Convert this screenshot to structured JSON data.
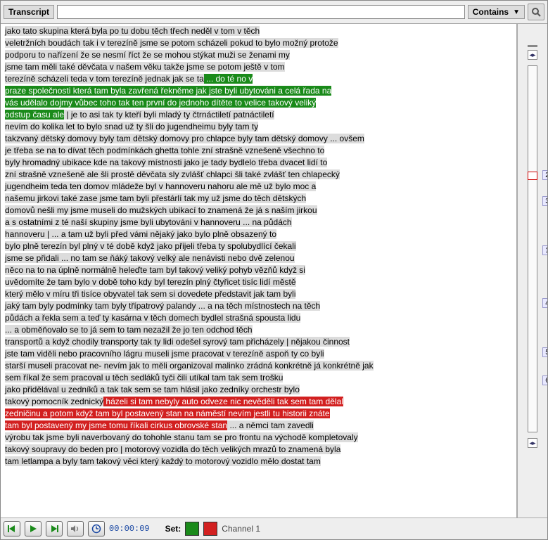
{
  "topbar": {
    "label": "Transcript",
    "input_value": "",
    "dropdown": "Contains"
  },
  "segments": [
    {
      "t": "jako tato skupina která byla po tu dobu těch třech neděl v tom v těch",
      "c": "n"
    },
    {
      "t": "\n"
    },
    {
      "t": "veletržních boudách tak i v terezíně jsme se potom scházeli pokud to bylo možný protože",
      "c": "n"
    },
    {
      "t": "\n"
    },
    {
      "t": "podporu to nařízení že se nesmí říct že se mohou stýkat muži se ženami my",
      "c": "n"
    },
    {
      "t": "\n"
    },
    {
      "t": "jsme tam měli také děvčata v našem věku takže jsme se potom ještě v tom",
      "c": "n"
    },
    {
      "t": "\n"
    },
    {
      "t": "terezíně scházeli teda v tom terezíně jednak jak se ta",
      "c": "n"
    },
    {
      "t": " ... do té no v",
      "c": "g"
    },
    {
      "t": "\n"
    },
    {
      "t": "praze společnosti která tam byla zavřená řekněme jak jste byli ubytováni a celá řada na",
      "c": "g"
    },
    {
      "t": "\n"
    },
    {
      "t": "vás udělalo dojmy vůbec toho tak ten první do jednoho dítěte to velice takový veliký",
      "c": "g"
    },
    {
      "t": "\n"
    },
    {
      "t": "odstup času ale",
      "c": "g"
    },
    {
      "t": " | je to asi tak ty kteří byli mladý ty čtrnáctiletí patnáctiletí",
      "c": "n"
    },
    {
      "t": "\n"
    },
    {
      "t": "nevím do kolika let to bylo snad už ty šli do jugendheimu byly tam ty",
      "c": "n"
    },
    {
      "t": "\n"
    },
    {
      "t": "takzvaný dětský domovy byly tam dětský domovy pro chlapce byly tam dětský domovy ... ovšem",
      "c": "n"
    },
    {
      "t": "\n"
    },
    {
      "t": "je třeba se na to dívat těch podmínkách ghetta tohle zní strašně vznešeně všechno to",
      "c": "n"
    },
    {
      "t": "\n"
    },
    {
      "t": "byly hromadný ubikace kde na takový místnosti jako je tady bydlelo třeba dvacet lidí to",
      "c": "n"
    },
    {
      "t": "\n"
    },
    {
      "t": "zní strašně vznešeně ale šli prostě děvčata sly zvlášť chlapci šli také zvlášť ten chlapecký",
      "c": "n"
    },
    {
      "t": "\n"
    },
    {
      "t": "jugendheim teda ten domov mládeže byl v hannoveru nahoru ale mě už bylo moc a",
      "c": "n"
    },
    {
      "t": "\n"
    },
    {
      "t": "našemu jirkovi také zase jsme tam byli přestárlí tak my už jsme do těch dětských",
      "c": "n"
    },
    {
      "t": "\n"
    },
    {
      "t": "domovů nešli my jsme museli do mužských ubikací to znamená že já s naším jirkou",
      "c": "n"
    },
    {
      "t": "\n"
    },
    {
      "t": "a s ostatními z té naší skupiny jsme byli ubytováni v hannoveru ... na půdách",
      "c": "n"
    },
    {
      "t": "\n"
    },
    {
      "t": "hannoveru | ... a tam už byli před vámi nějaký jako bylo plně obsazený to",
      "c": "n"
    },
    {
      "t": "\n"
    },
    {
      "t": "bylo plně terezín byl plný v té době když jako přijeli třeba ty spolubydlící čekali",
      "c": "n"
    },
    {
      "t": "\n"
    },
    {
      "t": "jsme se přidali ... no tam se ňáký takový velký ale nenávisti nebo dvě zelenou",
      "c": "n"
    },
    {
      "t": "\n"
    },
    {
      "t": "něco na to na úplně normálně heleďte tam byl takový veliký pohyb vězňů když si",
      "c": "n"
    },
    {
      "t": "\n"
    },
    {
      "t": "uvědomíte že tam bylo v době toho kdy byl terezín plný čtyřicet tisíc lidí městě",
      "c": "n"
    },
    {
      "t": "\n"
    },
    {
      "t": "který mělo v míru tři tisíce obyvatel tak sem si dovedete představit jak tam byli",
      "c": "n"
    },
    {
      "t": "\n"
    },
    {
      "t": "jaký tam byly podmínky tam byly třípatrový palandy ... a na těch místnostech na těch",
      "c": "n"
    },
    {
      "t": "\n"
    },
    {
      "t": "půdách a řekla sem a teď ty kasárna v těch domech bydlel strašná spousta lidu",
      "c": "n"
    },
    {
      "t": "\n"
    },
    {
      "t": "... a obměňovalo se to já sem to tam nezažil že jo ten odchod těch",
      "c": "n"
    },
    {
      "t": "\n"
    },
    {
      "t": "transportů a když chodily transporty tak ty lidi odešel syrový tam přicházely | nějakou činnost",
      "c": "n"
    },
    {
      "t": "\n"
    },
    {
      "t": "jste tam viděli nebo pracovního lágru museli jsme pracovat v terezíně aspoň ty co byli",
      "c": "n"
    },
    {
      "t": "\n"
    },
    {
      "t": "starší museli pracovat ne- nevím jak to měli organizoval malinko zrádná konkrétně já konkrétně jak",
      "c": "n"
    },
    {
      "t": "\n"
    },
    {
      "t": "sem říkal že sem pracoval u těch sedláků tyči čili utíkal tam tak sem trošku",
      "c": "n"
    },
    {
      "t": "\n"
    },
    {
      "t": "jako přidělával u zedníků a tak tak sem se tam hlásil jako zedníky orchestr bylo",
      "c": "n"
    },
    {
      "t": "\n"
    },
    {
      "t": "takový pomocník zednický",
      "c": "n"
    },
    {
      "t": " házeli si tam nebyly auto odveze nic nevěděli tak sem tam dělal",
      "c": "r"
    },
    {
      "t": "\n"
    },
    {
      "t": "zedničinu a potom když tam byl postavený stan na náměstí nevím jestli tu historii znáte",
      "c": "r"
    },
    {
      "t": "\n"
    },
    {
      "t": "tam byl postavený my jsme tomu říkali cirkus obrovské stan",
      "c": "r"
    },
    {
      "t": " ... a němci tam zavedli",
      "c": "n"
    },
    {
      "t": "\n"
    },
    {
      "t": "výrobu tak jsme byli naverbovaný do tohohle stanu tam se pro frontu na východě kompletovaly",
      "c": "n"
    },
    {
      "t": "\n"
    },
    {
      "t": "takový soupravy do beden pro | motorový vozidla do těch velikých mrazů to znamená byla",
      "c": "n"
    },
    {
      "t": "\n"
    },
    {
      "t": "tam letlampa a byly tam takový věci který každý to motorový vozidlo mělo dostat tam",
      "c": "n"
    },
    {
      "t": "\n"
    }
  ],
  "bottombar": {
    "time": "00:00:09",
    "set_label": "Set:",
    "channel": "Channel 1"
  },
  "ruler_numbers": [
    "2",
    "3",
    "1",
    "4",
    "5",
    "6"
  ]
}
